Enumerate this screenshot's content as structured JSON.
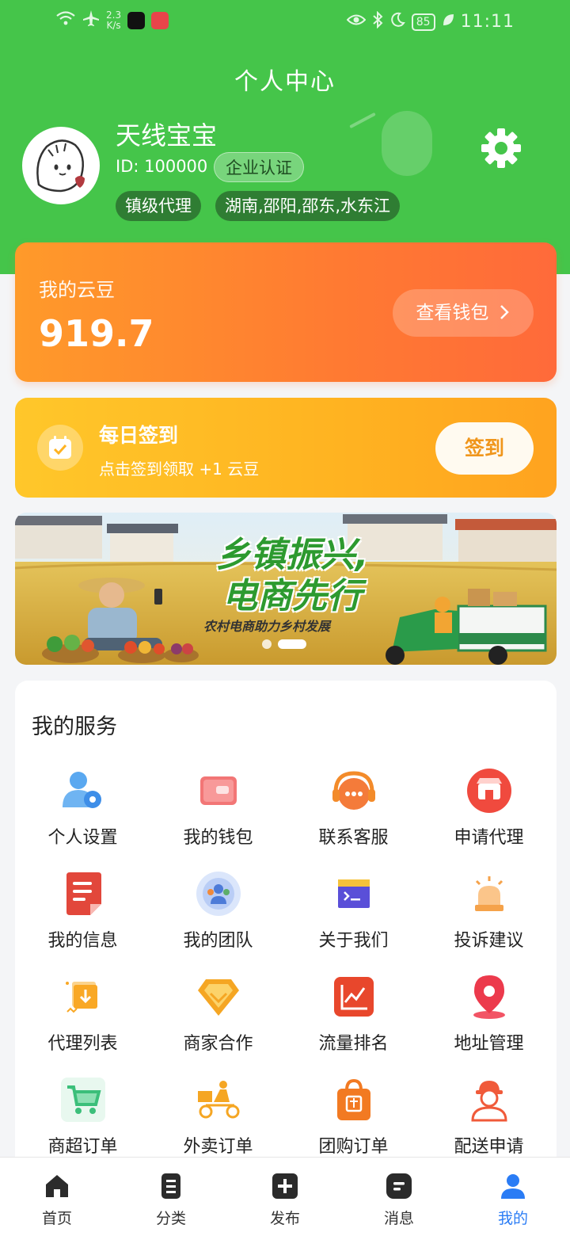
{
  "status_bar": {
    "speed": "2.3",
    "speed_unit": "K/s",
    "battery": "85",
    "time": "11:11"
  },
  "header": {
    "title": "个人中心",
    "username": "天线宝宝",
    "user_id": "ID: 100000",
    "verify_badge": "企业认证",
    "tags": [
      "镇级代理",
      "湖南,邵阳,邵东,水东江"
    ]
  },
  "wallet": {
    "label": "我的云豆",
    "value": "919.7",
    "button": "查看钱包",
    "button_icon": "chevron-right-icon"
  },
  "sign_in": {
    "title": "每日签到",
    "subtitle": "点击签到领取 +1 云豆",
    "button": "签到"
  },
  "banner": {
    "title_line1": "乡镇振兴,",
    "title_line2": "电商先行",
    "subtitle": "农村电商助力乡村发展",
    "dots": 2,
    "active_dot": 2
  },
  "services": {
    "title": "我的服务",
    "items": [
      {
        "label": "个人设置",
        "icon": "user-settings-icon"
      },
      {
        "label": "我的钱包",
        "icon": "wallet-icon"
      },
      {
        "label": "联系客服",
        "icon": "customer-service-icon"
      },
      {
        "label": "申请代理",
        "icon": "store-icon"
      },
      {
        "label": "我的信息",
        "icon": "document-icon"
      },
      {
        "label": "我的团队",
        "icon": "team-icon"
      },
      {
        "label": "关于我们",
        "icon": "terminal-icon"
      },
      {
        "label": "投诉建议",
        "icon": "alarm-icon"
      },
      {
        "label": "代理列表",
        "icon": "download-box-icon"
      },
      {
        "label": "商家合作",
        "icon": "diamond-icon"
      },
      {
        "label": "流量排名",
        "icon": "trend-chart-icon"
      },
      {
        "label": "地址管理",
        "icon": "location-pin-icon"
      },
      {
        "label": "商超订单",
        "icon": "shopping-cart-icon"
      },
      {
        "label": "外卖订单",
        "icon": "delivery-scooter-icon"
      },
      {
        "label": "团购订单",
        "icon": "group-bag-icon"
      },
      {
        "label": "配送申请",
        "icon": "courier-icon"
      }
    ]
  },
  "bottom_nav": {
    "items": [
      {
        "label": "首页",
        "icon": "home-icon"
      },
      {
        "label": "分类",
        "icon": "category-icon"
      },
      {
        "label": "发布",
        "icon": "plus-icon"
      },
      {
        "label": "消息",
        "icon": "message-icon"
      },
      {
        "label": "我的",
        "icon": "profile-icon"
      }
    ],
    "active": "我的",
    "active_color": "#2a7cf5"
  },
  "colors": {
    "header_green": "#45c54a",
    "wallet_orange": "#ff7a32",
    "sign_yellow": "#ffb321"
  }
}
